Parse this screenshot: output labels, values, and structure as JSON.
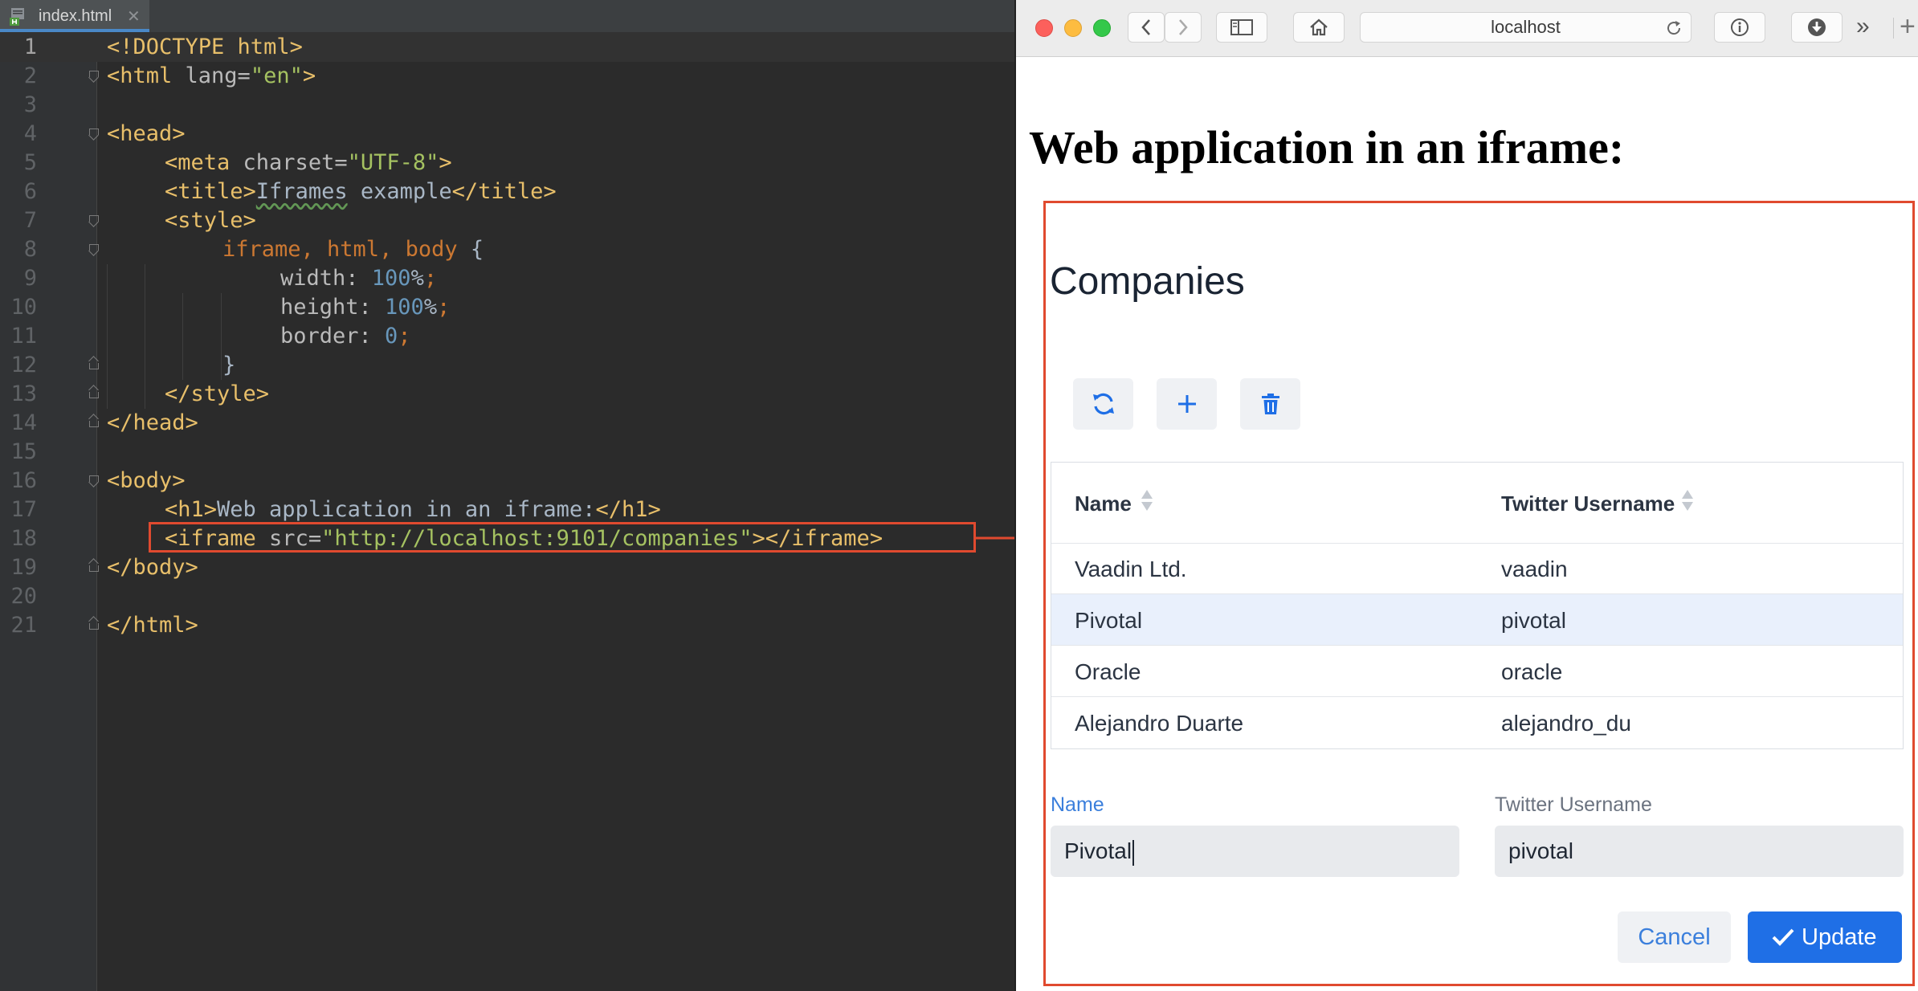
{
  "ide": {
    "tab_label": "index.html",
    "tab_close": "✕",
    "lines": [
      {
        "n": "1"
      },
      {
        "n": "2"
      },
      {
        "n": "3"
      },
      {
        "n": "4"
      },
      {
        "n": "5"
      },
      {
        "n": "6"
      },
      {
        "n": "7"
      },
      {
        "n": "8"
      },
      {
        "n": "9"
      },
      {
        "n": "10"
      },
      {
        "n": "11"
      },
      {
        "n": "12"
      },
      {
        "n": "13"
      },
      {
        "n": "14"
      },
      {
        "n": "15"
      },
      {
        "n": "16"
      },
      {
        "n": "17"
      },
      {
        "n": "18"
      },
      {
        "n": "19"
      },
      {
        "n": "20"
      },
      {
        "n": "21"
      }
    ],
    "code": {
      "doctype": "<!DOCTYPE html>",
      "html_open_tag": "<html",
      "html_open_attr": " lang=",
      "html_open_val": "\"en\"",
      "html_open_end": ">",
      "head_open": "<head>",
      "meta_tag": "<meta",
      "meta_attr": " charset=",
      "meta_val": "\"UTF-8\"",
      "meta_end": ">",
      "title_open": "<title>",
      "title_text": "Iframes",
      "title_text2": " example",
      "title_close": "</title>",
      "style_open": "<style>",
      "selector": "iframe, html, body",
      "brace_open": " {",
      "width_prop": "width: ",
      "width_val": "100",
      "width_unit": "%",
      "semi": ";",
      "height_prop": "height: ",
      "height_val": "100",
      "height_unit": "%",
      "border_prop": "border: ",
      "border_val": "0",
      "brace_close": "}",
      "style_close": "</style>",
      "head_close": "</head>",
      "body_open": "<body>",
      "h1_open": "<h1>",
      "h1_text": "Web application in an iframe:",
      "h1_close": "</h1>",
      "iframe_tag": "<iframe",
      "iframe_attr": " src=",
      "iframe_val": "\"http://localhost:9101/companies\"",
      "iframe_end": "></iframe>",
      "body_close": "</body>",
      "html_close": "</html>"
    }
  },
  "browser": {
    "address": "localhost",
    "overflow_label": "»",
    "new_tab_label": "+",
    "page_heading": "Web application in an iframe:"
  },
  "app": {
    "title": "Companies",
    "grid": {
      "columns": [
        "Name",
        "Twitter Username"
      ],
      "rows": [
        {
          "name": "Vaadin Ltd.",
          "twitter": "vaadin"
        },
        {
          "name": "Pivotal",
          "twitter": "pivotal"
        },
        {
          "name": "Oracle",
          "twitter": "oracle"
        },
        {
          "name": "Alejandro Duarte",
          "twitter": "alejandro_du"
        }
      ],
      "selected_index": 1
    },
    "form": {
      "name_label": "Name",
      "name_value": "Pivotal",
      "twitter_label": "Twitter Username",
      "twitter_value": "pivotal",
      "cancel_label": "Cancel",
      "update_label": "Update"
    }
  },
  "colors": {
    "highlight": "#e04a2f",
    "primary": "#1f6fe6",
    "selected_row": "#e9f0fc"
  }
}
